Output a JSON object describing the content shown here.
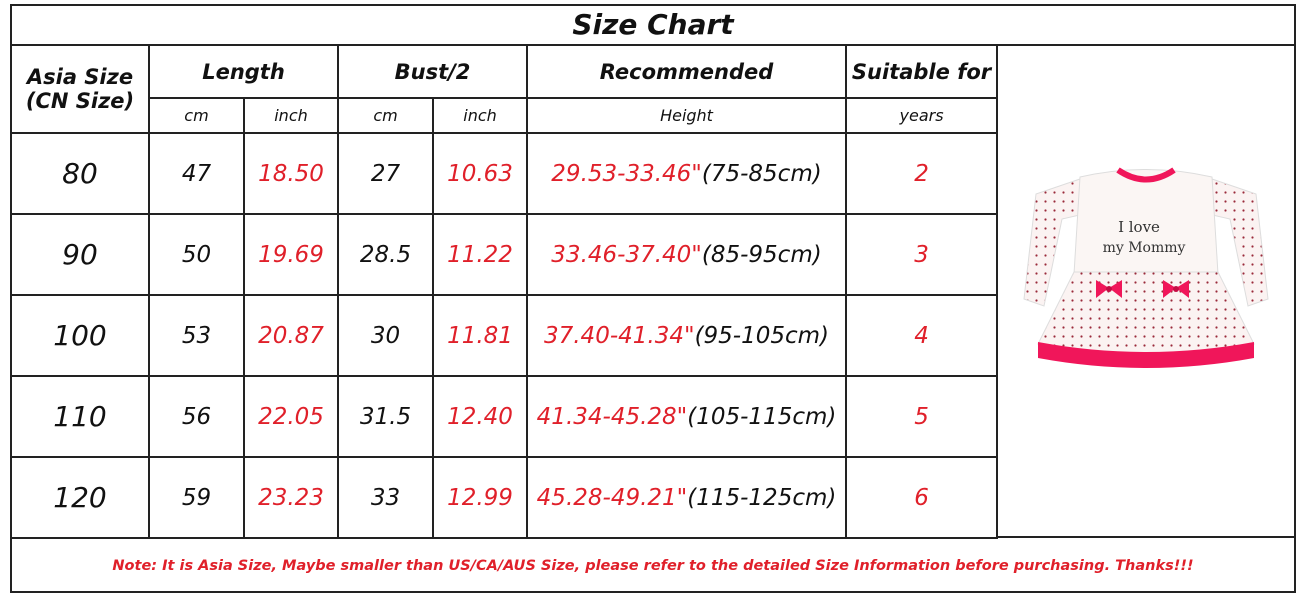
{
  "title": "Size Chart",
  "headers": {
    "asia_size": "Asia Size",
    "cn_size": "(CN Size)",
    "length": "Length",
    "bust": "Bust/2",
    "recommended": "Recommended",
    "suitable": "Suitable for"
  },
  "subheaders": {
    "length_cm": "cm",
    "length_inch": "inch",
    "bust_cm": "cm",
    "bust_inch": "inch",
    "height": "Height",
    "years": "years"
  },
  "rows": [
    {
      "size": "80",
      "length_cm": "47",
      "length_inch": "18.50",
      "bust_cm": "27",
      "bust_inch": "10.63",
      "height": "29.53-33.46\"",
      "height_cm": "(75-85cm)",
      "years": "2"
    },
    {
      "size": "90",
      "length_cm": "50",
      "length_inch": "19.69",
      "bust_cm": "28.5",
      "bust_inch": "11.22",
      "height": "33.46-37.40\"",
      "height_cm": "(85-95cm)",
      "years": "3"
    },
    {
      "size": "100",
      "length_cm": "53",
      "length_inch": "20.87",
      "bust_cm": "30",
      "bust_inch": "11.81",
      "height": "37.40-41.34\"",
      "height_cm": "(95-105cm)",
      "years": "4"
    },
    {
      "size": "110",
      "length_cm": "56",
      "length_inch": "22.05",
      "bust_cm": "31.5",
      "bust_inch": "12.40",
      "height": "41.34-45.28\"",
      "height_cm": "(105-115cm)",
      "years": "5"
    },
    {
      "size": "120",
      "length_cm": "59",
      "length_inch": "23.23",
      "bust_cm": "33",
      "bust_inch": "12.99",
      "height": "45.28-49.21\"",
      "height_cm": "(115-125cm)",
      "years": "6"
    }
  ],
  "dress": {
    "print_line1": "I love",
    "print_line2": "my Mommy"
  },
  "note": "Note: It is Asia Size, Maybe smaller than US/CA/AUS Size, please refer to the detailed Size Information before purchasing. Thanks!!!",
  "colors": {
    "accent_red": "#e0202a",
    "dress_pink": "#f0165a",
    "border": "#222222"
  }
}
